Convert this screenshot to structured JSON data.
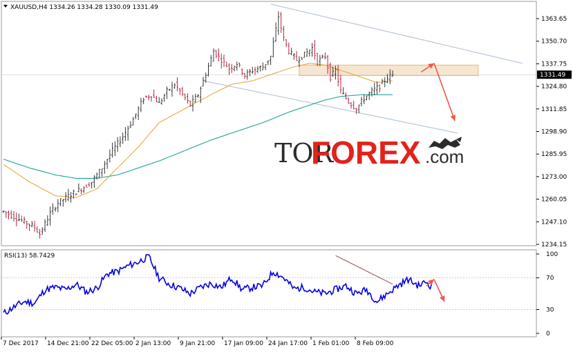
{
  "chart_data": [
    {
      "type": "candlestick",
      "header": {
        "symbol": "XAUUSD,H4",
        "open": "1334.26",
        "high": "1334.28",
        "low": "1330.09",
        "close": "1331.49"
      },
      "current_price_label": "1331.49",
      "y_ticks": [
        "1363.65",
        "1350.70",
        "1337.75",
        "1324.80",
        "1311.85",
        "1298.90",
        "1285.95",
        "1273.00",
        "1260.05",
        "1247.10",
        "1234.15"
      ],
      "ylim": [
        1234.15,
        1363.65
      ],
      "x_ticks": [
        "7 Dec 2017",
        "14 Dec 21:00",
        "22 Dec 05:00",
        "2 Jan 13:00",
        "9 Jan 21:00",
        "17 Jan 09:00",
        "24 Jan 17:00",
        "1 Feb 01:00",
        "8 Feb 09:00"
      ],
      "price_path": [
        [
          0,
          1253
        ],
        [
          4,
          1250
        ],
        [
          8,
          1247
        ],
        [
          12,
          1244
        ],
        [
          14,
          1240
        ],
        [
          16,
          1246
        ],
        [
          18,
          1252
        ],
        [
          21,
          1258
        ],
        [
          25,
          1262
        ],
        [
          30,
          1266
        ],
        [
          34,
          1270
        ],
        [
          38,
          1278
        ],
        [
          42,
          1288
        ],
        [
          46,
          1296
        ],
        [
          50,
          1306
        ],
        [
          54,
          1318
        ],
        [
          57,
          1320
        ],
        [
          60,
          1315
        ],
        [
          63,
          1322
        ],
        [
          66,
          1326
        ],
        [
          69,
          1320
        ],
        [
          72,
          1314
        ],
        [
          75,
          1320
        ],
        [
          78,
          1332
        ],
        [
          81,
          1345
        ],
        [
          84,
          1340
        ],
        [
          87,
          1335
        ],
        [
          90,
          1338
        ],
        [
          93,
          1331
        ],
        [
          96,
          1334
        ],
        [
          100,
          1336
        ],
        [
          103,
          1342
        ],
        [
          106,
          1365
        ],
        [
          108,
          1352
        ],
        [
          110,
          1345
        ],
        [
          113,
          1340
        ],
        [
          116,
          1343
        ],
        [
          119,
          1347
        ],
        [
          121,
          1339
        ],
        [
          124,
          1342
        ],
        [
          126,
          1330
        ],
        [
          128,
          1334
        ],
        [
          130,
          1322
        ],
        [
          133,
          1316
        ],
        [
          136,
          1312
        ],
        [
          139,
          1318
        ],
        [
          142,
          1322
        ],
        [
          145,
          1325
        ],
        [
          148,
          1330
        ],
        [
          150,
          1331.49
        ]
      ],
      "ma_fast_color": "#e8a93c",
      "ma_slow_color": "#1aa39a",
      "ma_fast": [
        [
          0,
          1280
        ],
        [
          10,
          1270
        ],
        [
          20,
          1262
        ],
        [
          28,
          1261
        ],
        [
          36,
          1266
        ],
        [
          44,
          1278
        ],
        [
          52,
          1290
        ],
        [
          60,
          1304
        ],
        [
          70,
          1312
        ],
        [
          80,
          1320
        ],
        [
          88,
          1326
        ],
        [
          96,
          1328
        ],
        [
          104,
          1332
        ],
        [
          112,
          1336
        ],
        [
          118,
          1338
        ],
        [
          124,
          1337
        ],
        [
          130,
          1334
        ],
        [
          138,
          1330
        ],
        [
          144,
          1327
        ],
        [
          150,
          1328
        ]
      ],
      "ma_slow": [
        [
          0,
          1283
        ],
        [
          10,
          1278
        ],
        [
          20,
          1274
        ],
        [
          28,
          1272
        ],
        [
          36,
          1272
        ],
        [
          44,
          1274
        ],
        [
          52,
          1278
        ],
        [
          60,
          1282
        ],
        [
          70,
          1288
        ],
        [
          80,
          1294
        ],
        [
          90,
          1299
        ],
        [
          100,
          1304
        ],
        [
          110,
          1310
        ],
        [
          118,
          1314
        ],
        [
          124,
          1317
        ],
        [
          130,
          1319
        ],
        [
          138,
          1320
        ],
        [
          145,
          1320
        ],
        [
          150,
          1320
        ]
      ],
      "channel_upper": [
        [
          103,
          1372
        ],
        [
          200,
          1338
        ]
      ],
      "channel_lower": [
        [
          77,
          1328
        ],
        [
          175,
          1298
        ]
      ],
      "zone": {
        "x0": 114,
        "x1": 183,
        "y_low": 1331,
        "y_high": 1337
      },
      "forecast_up": [
        [
          161,
          1333
        ],
        [
          166,
          1338
        ]
      ],
      "forecast_down": [
        [
          166,
          1338
        ],
        [
          174,
          1305
        ]
      ]
    },
    {
      "type": "line",
      "header": "RSI(13) 58.7429",
      "y_ticks": [
        "100",
        "70",
        "30",
        "0"
      ],
      "ylim": [
        0,
        100
      ],
      "line_color": "#0000dd",
      "rsi_path": [
        [
          0,
          25
        ],
        [
          4,
          33
        ],
        [
          8,
          40
        ],
        [
          12,
          38
        ],
        [
          16,
          55
        ],
        [
          20,
          58
        ],
        [
          24,
          55
        ],
        [
          28,
          62
        ],
        [
          32,
          52
        ],
        [
          36,
          57
        ],
        [
          40,
          75
        ],
        [
          44,
          78
        ],
        [
          48,
          85
        ],
        [
          52,
          90
        ],
        [
          56,
          97
        ],
        [
          60,
          70
        ],
        [
          64,
          62
        ],
        [
          68,
          57
        ],
        [
          72,
          50
        ],
        [
          76,
          58
        ],
        [
          80,
          63
        ],
        [
          84,
          58
        ],
        [
          88,
          70
        ],
        [
          92,
          55
        ],
        [
          96,
          58
        ],
        [
          100,
          60
        ],
        [
          104,
          78
        ],
        [
          108,
          70
        ],
        [
          112,
          56
        ],
        [
          116,
          58
        ],
        [
          120,
          52
        ],
        [
          124,
          50
        ],
        [
          128,
          55
        ],
        [
          132,
          60
        ],
        [
          136,
          50
        ],
        [
          140,
          55
        ],
        [
          144,
          40
        ],
        [
          148,
          50
        ],
        [
          152,
          60
        ],
        [
          156,
          68
        ],
        [
          160,
          60
        ],
        [
          163,
          65
        ],
        [
          165,
          58.74
        ]
      ],
      "trendline": [
        [
          175,
          98
        ],
        [
          205,
          62
        ]
      ],
      "forecast_up": [
        [
          163,
          60
        ],
        [
          166,
          68
        ]
      ],
      "forecast_down": [
        [
          166,
          68
        ],
        [
          170,
          40
        ]
      ]
    }
  ]
}
